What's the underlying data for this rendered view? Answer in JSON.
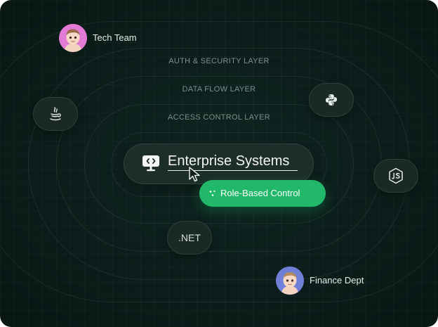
{
  "diagram": {
    "hub": {
      "icon": "monitor-code-icon",
      "title": "Enterprise Systems"
    },
    "layers": [
      {
        "label": "ACCESS CONTROL LAYER"
      },
      {
        "label": "DATA FLOW LAYER"
      },
      {
        "label": "AUTH & SECURITY LAYER"
      }
    ],
    "badge": {
      "icon": "sparkle-dots-icon",
      "label": "Role-Based Control",
      "color": "#22b86a"
    },
    "technologies": [
      {
        "name": "java",
        "icon": "java-icon"
      },
      {
        "name": "python",
        "icon": "python-icon"
      },
      {
        "name": "nodejs",
        "icon": "nodejs-icon"
      },
      {
        "name": "dotnet",
        "label": ".NET"
      }
    ],
    "groups": [
      {
        "label": "Tech Team",
        "avatar_color": "#e27ad6"
      },
      {
        "label": "Finance Dept",
        "avatar_color": "#6f7fd8"
      }
    ]
  }
}
